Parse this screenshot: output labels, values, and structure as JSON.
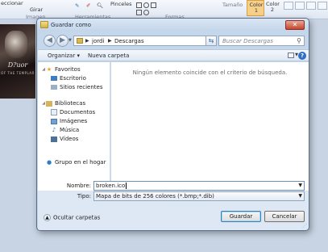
{
  "paint": {
    "ribbon_left_label": "eccionar",
    "rotate_label": "Girar",
    "image_group_label": "Imagen",
    "tools_group_label": "Herramientas",
    "brushes_label": "Pinceles",
    "shapes_group_label": "Formas",
    "size_label": "Tamaño",
    "color1_label": "Color 1",
    "color2_label": "Color 2",
    "image_logo_text": "D?uor",
    "image_sub_text": "OF THE TEMPLAR"
  },
  "dialog": {
    "title": "Guardar como",
    "close_glyph": "✕",
    "address": {
      "crumbs": [
        "jordi",
        "Descargas"
      ]
    },
    "search": {
      "placeholder": "Buscar Descargas"
    },
    "toolbar": {
      "organize_label": "Organizar",
      "new_folder_label": "Nueva carpeta",
      "help_glyph": "?"
    },
    "nav": {
      "favorites_label": "Favoritos",
      "desktop_label": "Escritorio",
      "recent_label": "Sitios recientes",
      "libraries_label": "Bibliotecas",
      "documents_label": "Documentos",
      "images_label": "Imágenes",
      "music_label": "Música",
      "videos_label": "Vídeos",
      "homegroup_label": "Grupo en el hogar"
    },
    "empty_message": "Ningún elemento coincide con el criterio de búsqueda.",
    "filename_label": "Nombre:",
    "filename_value": "broken.ico",
    "filetype_label": "Tipo:",
    "filetype_value": "Mapa de bits de 256 colores (*.bmp;*.dib)",
    "hide_folders_label": "Ocultar carpetas",
    "save_label": "Guardar",
    "cancel_label": "Cancelar"
  },
  "colors": {
    "titlebar": "#c3d5ea",
    "close_button": "#c7442e",
    "accent_blue": "#2e6fc4"
  }
}
